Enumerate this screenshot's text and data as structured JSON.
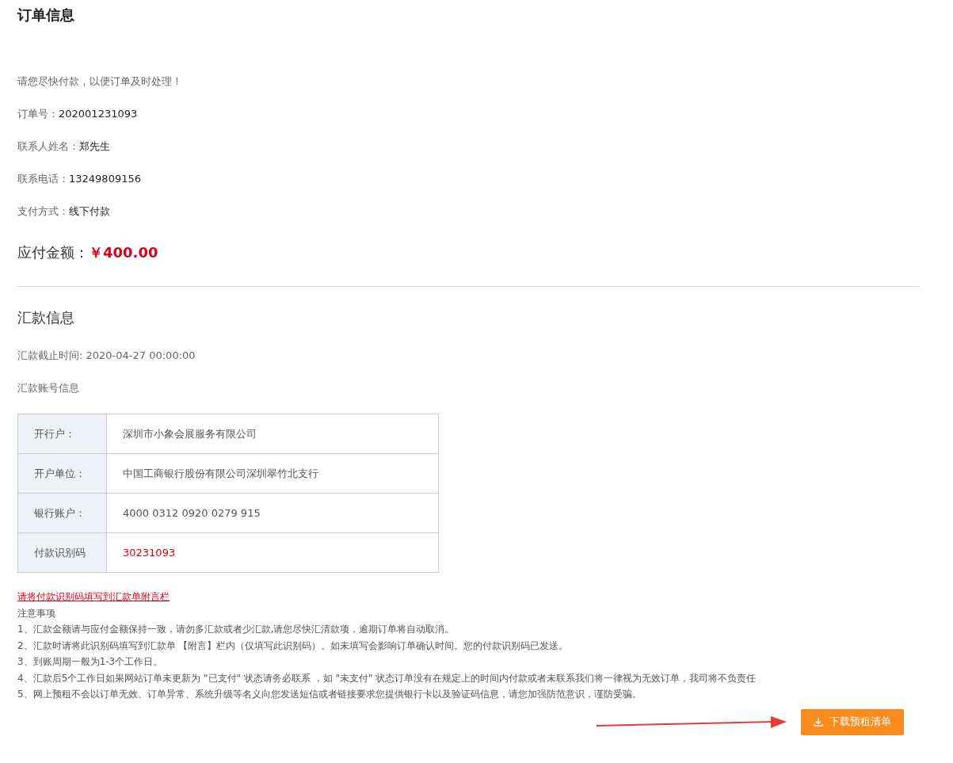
{
  "order_info": {
    "title": "订单信息",
    "notice": "请您尽快付款，以便订单及时处理！",
    "fields": [
      {
        "label": "订单号：",
        "value": "202001231093"
      },
      {
        "label": "联系人姓名：",
        "value": "郑先生"
      },
      {
        "label": "联系电话：",
        "value": "13249809156"
      },
      {
        "label": "支付方式：",
        "value": "线下付款"
      }
    ],
    "amount": {
      "label": "应付金额：",
      "value": "￥400.00"
    }
  },
  "remittance": {
    "title": "汇款信息",
    "deadline": "汇款截止时间: 2020-04-27 00:00:00",
    "account_heading": "汇款账号信息",
    "table": [
      {
        "label": "开行户：",
        "value": "深圳市小象会展服务有限公司",
        "kind": "text"
      },
      {
        "label": "开户单位：",
        "value": "中国工商银行股份有限公司深圳翠竹北支行",
        "kind": "text"
      },
      {
        "label": "银行账户：",
        "value": "4000 0312 0920 0279 915",
        "kind": "text"
      },
      {
        "label": "付款识别码",
        "value": "30231093",
        "kind": "code"
      }
    ]
  },
  "notes": {
    "link": "请将付款识别码填写到汇款单附言栏",
    "heading": "注意事项",
    "items": [
      "1、汇款金额请与应付金额保持一致，请勿多汇款或者少汇款,请您尽快汇清款项，逾期订单将自动取消。",
      "2、汇款时请将此识别码填写到汇款单 【附言】栏内（仅填写此识别码）。如未填写会影响订单确认时间。您的付款识别码已发送。",
      "3、到账周期一般为1-3个工作日。",
      "4、汇款后5个工作日如果网站订单未更新为 \"已支付\" 状态请务必联系 ，如 \"未支付\" 状态订单没有在规定上的时间内付款或者未联系我们将一律视为无效订单，我司将不负责任",
      "5、网上预租不会以订单无效、订单异常、系统升级等名义向您发送短信或者链接要求您提供银行卡以及验证码信息，请您加强防范意识，谨防受骗。"
    ]
  },
  "download_button": {
    "label": "下载预租清单"
  }
}
